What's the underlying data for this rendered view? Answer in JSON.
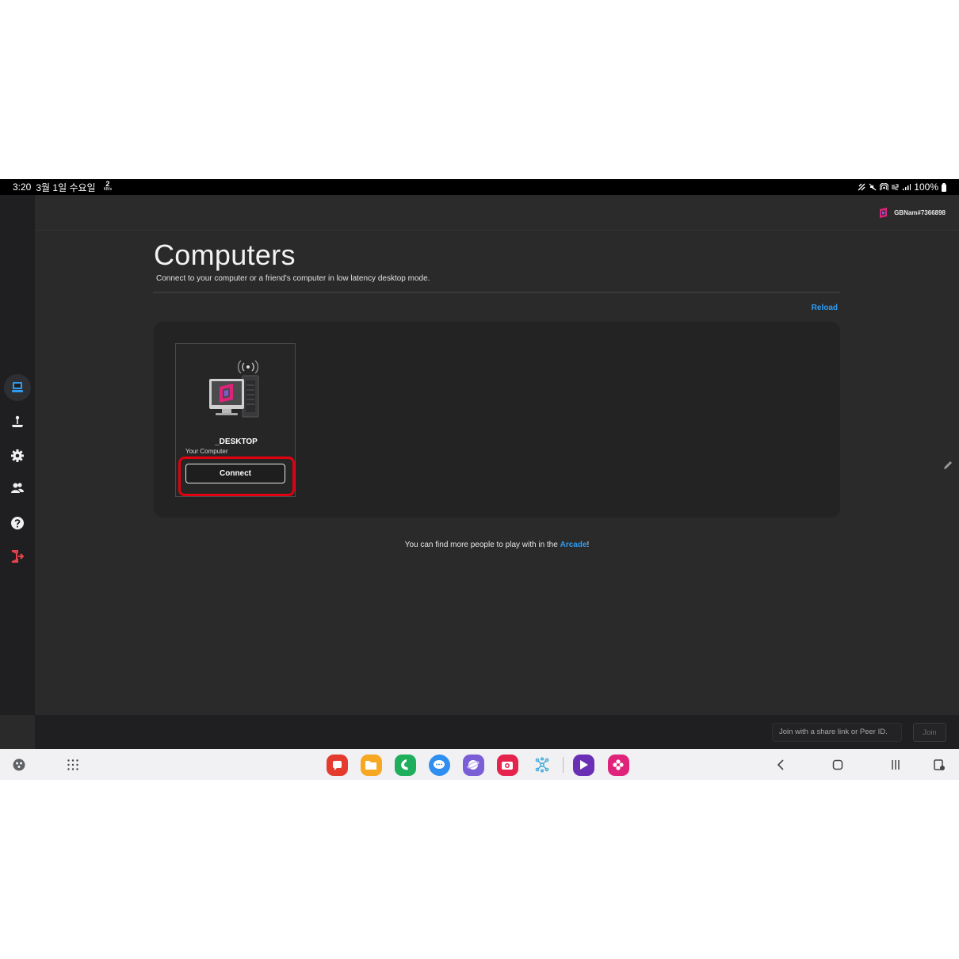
{
  "status_bar": {
    "time": "3:20",
    "date": "3월 1일 수요일",
    "net_speed_value": "2",
    "net_speed_unit": "KB/s",
    "battery": "100%"
  },
  "header": {
    "username": "GBNam#7366898"
  },
  "page": {
    "title": "Computers",
    "subtitle": "Connect to your computer or a friend's computer in low latency desktop mode.",
    "reload_label": "Reload"
  },
  "computers": [
    {
      "name": "_DESKTOP",
      "owner": "Your Computer",
      "connect_label": "Connect"
    }
  ],
  "arcade_note": {
    "prefix": "You can find more people to play with in the ",
    "link": "Arcade",
    "suffix": "!"
  },
  "join_bar": {
    "placeholder": "Join with a share link or Peer ID.",
    "join_label": "Join"
  },
  "sidebar": {
    "items": [
      {
        "icon": "computer-icon",
        "active": true
      },
      {
        "icon": "arcade-joystick-icon",
        "active": false
      },
      {
        "icon": "settings-gear-icon",
        "active": false
      },
      {
        "icon": "friends-icon",
        "active": false
      },
      {
        "icon": "help-icon",
        "active": false
      },
      {
        "icon": "logout-icon",
        "active": false
      }
    ]
  },
  "taskbar_apps": [
    {
      "name": "flipboard-app-icon",
      "color": "#e53b2f"
    },
    {
      "name": "my-files-app-icon",
      "color": "#f7a823"
    },
    {
      "name": "phone-app-icon",
      "color": "#1fae5b"
    },
    {
      "name": "messages-app-icon",
      "color": "#2f8ff0"
    },
    {
      "name": "internet-app-icon",
      "color": "#7a5ed6"
    },
    {
      "name": "camera-app-icon",
      "color": "#e5234d"
    },
    {
      "name": "bixby-app-icon",
      "color": "#3aa7d8"
    },
    {
      "name": "video-player-app-icon",
      "color": "#6a2fb5"
    },
    {
      "name": "gallery-app-icon",
      "color": "#e0237a"
    }
  ],
  "colors": {
    "accent": "#2f9cf1",
    "highlight": "#e00010",
    "background": "#2a2a2b"
  }
}
